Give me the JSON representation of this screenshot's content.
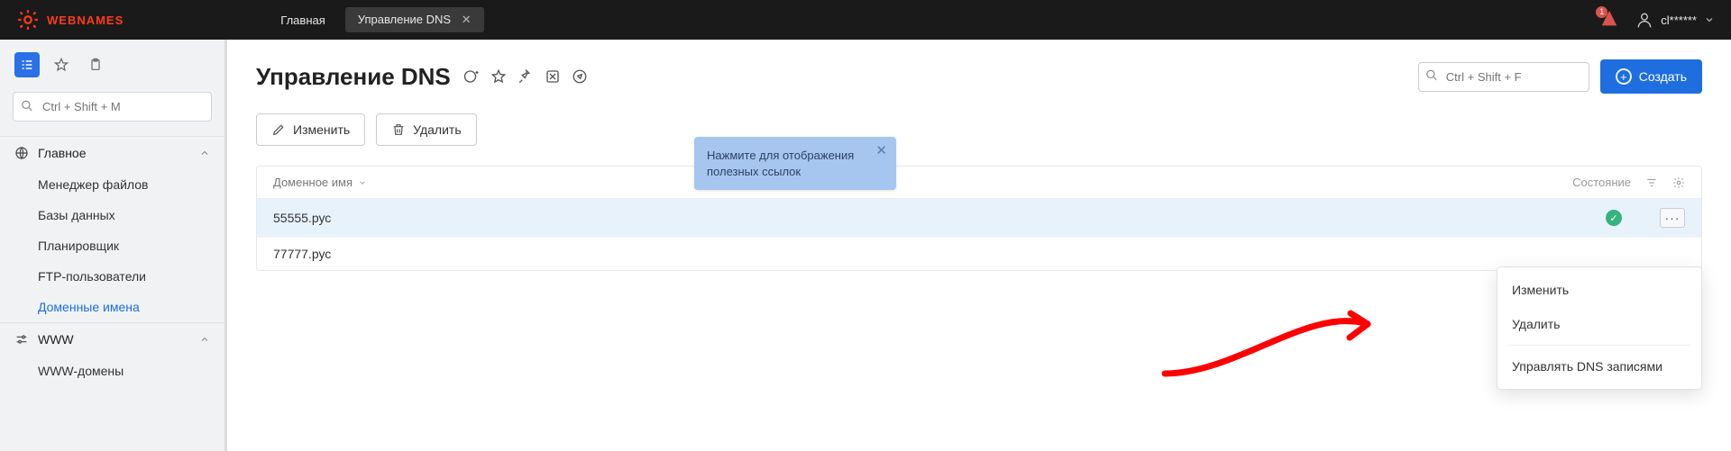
{
  "brand": "WEBNAMES",
  "topnav": {
    "home": "Главная",
    "active_tab": "Управление DNS"
  },
  "topbar": {
    "bell_count": "1",
    "username": "cl******"
  },
  "sidebar": {
    "search_placeholder": "Ctrl + Shift + M",
    "sections": [
      {
        "label": "Главное",
        "items": [
          {
            "label": "Менеджер файлов"
          },
          {
            "label": "Базы данных"
          },
          {
            "label": "Планировщик"
          },
          {
            "label": "FTP-пользователи"
          },
          {
            "label": "Доменные имена",
            "active": true
          }
        ]
      },
      {
        "label": "WWW",
        "items": [
          {
            "label": "WWW-домены"
          }
        ]
      }
    ]
  },
  "page": {
    "title": "Управление DNS",
    "search_placeholder": "Ctrl + Shift + F",
    "create_label": "Создать",
    "toolbar": {
      "edit": "Изменить",
      "delete": "Удалить"
    },
    "tooltip": "Нажмите для отображения полезных ссылок"
  },
  "table": {
    "col_name": "Доменное имя",
    "col_status": "Состояние",
    "rows": [
      {
        "name": "55555.рус",
        "status_ok": true,
        "selected": true
      },
      {
        "name": "77777.рус"
      }
    ]
  },
  "ctxmenu": {
    "edit": "Изменить",
    "delete": "Удалить",
    "manage": "Управлять DNS записями"
  }
}
